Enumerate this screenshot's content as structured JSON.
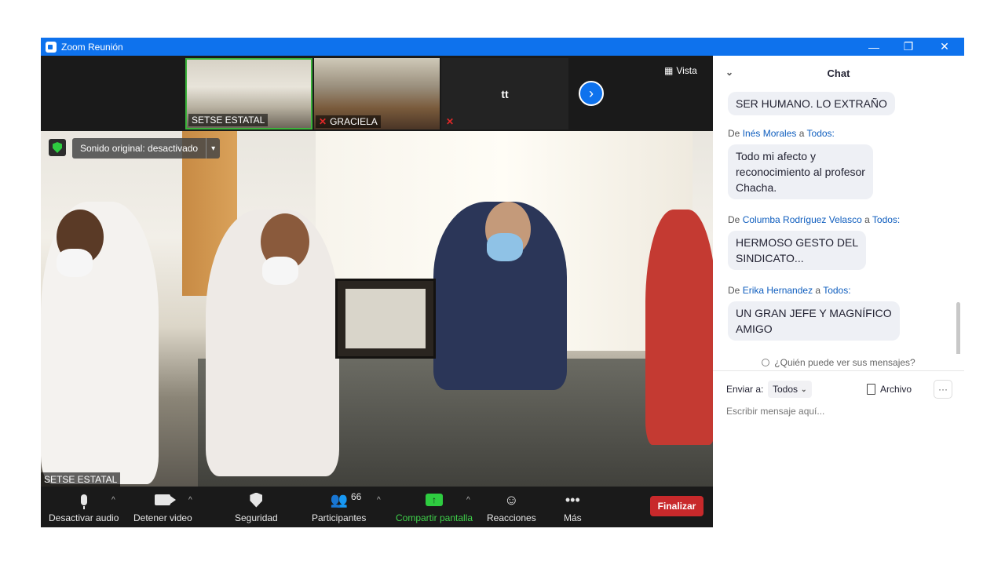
{
  "window": {
    "title": "Zoom Reunión",
    "min": "—",
    "max": "❐",
    "close": "✕"
  },
  "thumbnails": [
    {
      "name": "SETSE ESTATAL",
      "muted": false
    },
    {
      "name": "GRACIELA",
      "muted": true
    },
    {
      "name": "tt",
      "muted": true
    }
  ],
  "strip": {
    "next": "›",
    "vista_label": "Vista"
  },
  "main_video": {
    "sound_label": "Sonido original: desactivado",
    "sound_arrow": "▾",
    "speaker": "SETSE ESTATAL"
  },
  "toolbar": {
    "mute": "Desactivar audio",
    "video": "Detener video",
    "security": "Seguridad",
    "participants": "Participantes",
    "participants_count": "66",
    "share": "Compartir pantalla",
    "share_icon": "↑",
    "reactions": "Reacciones",
    "reactions_icon": "☺",
    "more": "Más",
    "more_icon": "•••",
    "caret": "^",
    "end": "Finalizar"
  },
  "chat": {
    "title": "Chat",
    "collapse_icon": "⌄",
    "messages": [
      {
        "text": "SER HUMANO. LO EXTRAÑO"
      },
      {
        "prefix": "De ",
        "sender": "Inés Morales",
        "mid": " a ",
        "to": "Todos:",
        "line1": "Todo mi afecto y",
        "line2": "reconocimiento al profesor",
        "line3": "Chacha."
      },
      {
        "prefix": "De ",
        "sender": "Columba Rodríguez Velasco",
        "mid": " a ",
        "to": "Todos:",
        "line1": "HERMOSO GESTO DEL",
        "line2": "SINDICATO..."
      },
      {
        "prefix": "De ",
        "sender": "Erika Hernandez",
        "mid": " a ",
        "to": "Todos:",
        "line1": "UN GRAN JEFE Y MAGNÍFICO",
        "line2": "AMIGO"
      }
    ],
    "who_can_see": "¿Quién puede ver sus mensajes?",
    "send_to_label": "Enviar a:",
    "send_to_value": "Todos",
    "send_to_caret": "⌄",
    "file_label": "Archivo",
    "more": "···",
    "placeholder": "Escribir mensaje aquí..."
  }
}
